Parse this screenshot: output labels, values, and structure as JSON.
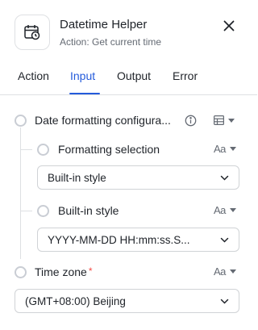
{
  "header": {
    "title": "Datetime Helper",
    "subtitle": "Action: Get current time",
    "app_icon": "calendar-clock-icon",
    "close_icon": "close-icon"
  },
  "tabs": [
    {
      "label": "Action",
      "active": false
    },
    {
      "label": "Input",
      "active": true
    },
    {
      "label": "Output",
      "active": false
    },
    {
      "label": "Error",
      "active": false
    }
  ],
  "fields": {
    "date_formatting": {
      "label": "Date formatting configura...",
      "info_icon": "info-icon",
      "type_icon": "table-icon"
    },
    "formatting_selection": {
      "label": "Formatting selection",
      "type_label": "Aa",
      "value": "Built-in style"
    },
    "builtin_style": {
      "label": "Built-in style",
      "type_label": "Aa",
      "value": "YYYY-MM-DD HH:mm:ss.S..."
    },
    "time_zone": {
      "label": "Time zone",
      "required_mark": "*",
      "type_label": "Aa",
      "value": "(GMT+08:00) Beijing"
    }
  },
  "colors": {
    "accent": "#245bdb",
    "required": "#f54a45",
    "border": "#dee0e3",
    "muted": "#646a73"
  }
}
